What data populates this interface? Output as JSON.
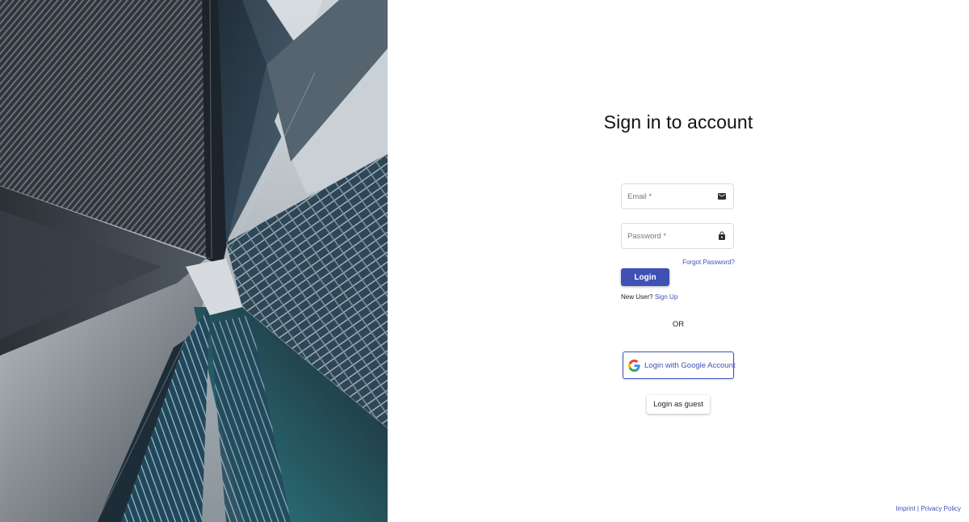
{
  "page": {
    "title": "Sign in to account"
  },
  "form": {
    "email_placeholder": "Email *",
    "email_value": "",
    "email_icon": "envelope-icon",
    "password_placeholder": "Password *",
    "password_value": "",
    "password_icon": "lock-icon",
    "forgot_label": "Forgot Password?",
    "login_label": "Login",
    "new_user_text": "New User?",
    "signup_label": "Sign Up",
    "or_text": "OR",
    "google_label": "Login with Google Account",
    "guest_label": "Login as guest"
  },
  "footer": {
    "imprint_label": "Imprint",
    "separator": "|",
    "privacy_label": "Privacy Policy"
  },
  "colors": {
    "accent": "#3f51b5",
    "text": "#222222",
    "border": "#dcdcdc"
  }
}
